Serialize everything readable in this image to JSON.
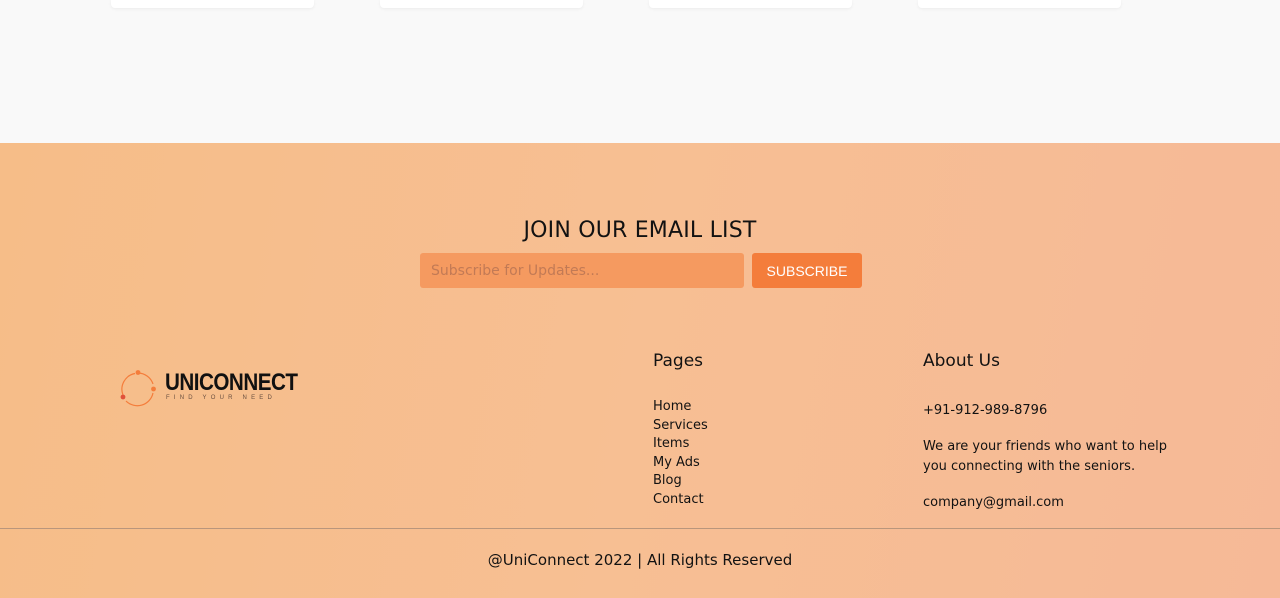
{
  "newsletter": {
    "title": "JOIN OUR EMAIL LIST",
    "input_placeholder": "Subscribe for Updates...",
    "button_label": "SUBSCRIBE"
  },
  "brand": {
    "name": "UNICONNECT",
    "tagline": "FIND YOUR NEED",
    "logo_icon": "orbit-dots-icon",
    "accent_color": "#f47d3b"
  },
  "pages": {
    "heading": "Pages",
    "links": [
      "Home",
      "Services",
      "Items",
      "My Ads",
      "Blog",
      "Contact"
    ]
  },
  "about": {
    "heading": "About Us",
    "phone": "+91-912-989-8796",
    "description": "We are your friends who want to help you connecting with the seniors.",
    "email": "company@gmail.com"
  },
  "copyright": "@UniConnect 2022 | All Rights Reserved"
}
